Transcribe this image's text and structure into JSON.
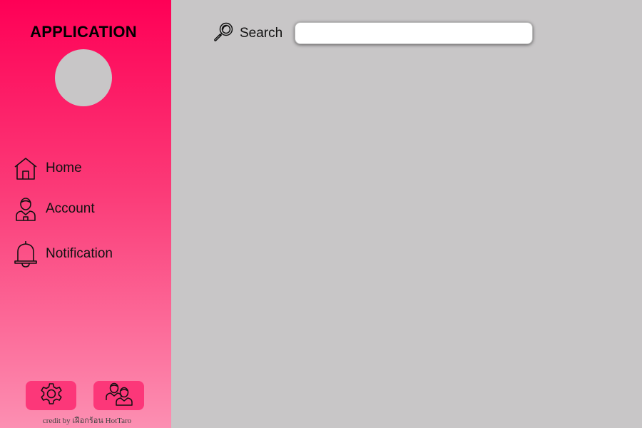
{
  "app": {
    "title": "APPLICATION"
  },
  "sidebar": {
    "items": [
      {
        "label": "Home",
        "icon": "home-icon"
      },
      {
        "label": "Account",
        "icon": "user-icon"
      },
      {
        "label": "Notification",
        "icon": "bell-icon"
      }
    ],
    "bottom_buttons": [
      {
        "icon": "gear-icon"
      },
      {
        "icon": "users-icon"
      }
    ],
    "credit": "credit by เฝือกร้อน HotTaro"
  },
  "search": {
    "label": "Search",
    "value": "",
    "placeholder": ""
  },
  "colors": {
    "sidebar_top": "#fe0056",
    "sidebar_bottom": "#fc8fb2",
    "button": "#fc3779",
    "background": "#c8c6c7"
  }
}
